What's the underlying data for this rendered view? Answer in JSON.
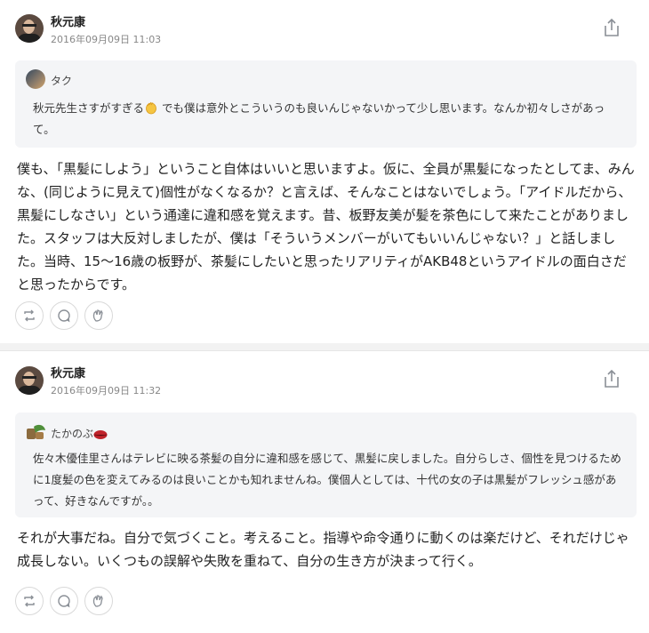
{
  "posts": [
    {
      "author": "秋元康",
      "timestamp": "2016年09月09日 11:03",
      "quote": {
        "author": "タク",
        "text_before_icon": "秋元先生さすがすぎる",
        "text_after_icon": " でも僕は意外とこういうのも良いんじゃないかって少し思います。なんか初々しさがあって。"
      },
      "body": "僕も、「黒髪にしよう」ということ自体はいいと思いますよ。仮に、全員が黒髪になったとしてま、みんな、(同じように見えて)個性がなくなるか？と言えば、そんなことはないでしょう。「アイドルだから、黒髪にしなさい」という通達に違和感を覚えます。昔、板野友美が髪を茶色にして来たことがありました。スタッフは大反対しましたが、僕は「そういうメンバーがいてもいいんじゃない？」と話しました。当時、15〜16歳の板野が、茶髪にしたいと思ったリアリティがAKB48というアイドルの面白さだと思ったからです。"
    },
    {
      "author": "秋元康",
      "timestamp": "2016年09月09日 11:32",
      "quote": {
        "author": "たかのぶ",
        "text": "佐々木優佳里さんはテレビに映る茶髪の自分に違和感を感じて、黒髪に戻しました。自分らしさ、個性を見つけるために1度髪の色を変えてみるのは良いことかも知れませんね。僕個人としては、十代の女の子は黒髪がフレッシュ感があって、好きなんですが。。"
      },
      "body": "それが大事だね。自分で気づくこと。考えること。指導や命令通りに動くのは楽だけど、それだけじゃ成長しない。いくつもの誤解や失敗を重ねて、自分の生き方が決まって行く。"
    }
  ],
  "icons": {
    "share": "share-icon",
    "repost": "repost-icon",
    "comment": "comment-icon",
    "clap": "clap-icon",
    "clap_emoji": "clap-emoji-icon",
    "lips_emoji": "lips-emoji-icon"
  },
  "colors": {
    "quote_bg": "#f4f5f7",
    "timestamp": "#888888",
    "icon": "#8a8f96"
  }
}
